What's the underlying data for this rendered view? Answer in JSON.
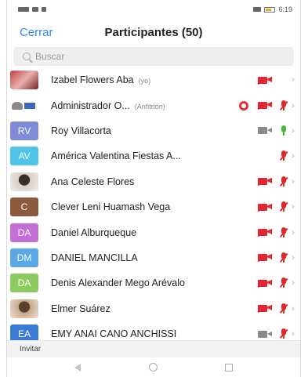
{
  "status_bar": {
    "time": "6:19",
    "battery_icon": "battery-icon",
    "signal_icon": "signal-icon"
  },
  "header": {
    "close_label": "Cerrar",
    "title": "Participantes (50)"
  },
  "search": {
    "placeholder": "Buscar"
  },
  "participants": [
    {
      "name": "Izabel Flowers Aba",
      "tag": "(yo)",
      "avatar": "photo",
      "avatar_text": "",
      "avatar_color": "#c04040",
      "rec": false,
      "cam": "off",
      "mic": "none"
    },
    {
      "name": "Administrador O...",
      "tag": "(Anfitrión)",
      "avatar": "logo",
      "avatar_text": "",
      "avatar_color": "#ffffff",
      "rec": true,
      "cam": "off",
      "mic": "off"
    },
    {
      "name": "Roy Villacorta",
      "tag": "",
      "avatar": "initials",
      "avatar_text": "RV",
      "avatar_color": "#7f8bd8",
      "rec": false,
      "cam": "on",
      "mic": "on"
    },
    {
      "name": "América Valentina Fiestas A...",
      "tag": "",
      "avatar": "initials",
      "avatar_text": "AV",
      "avatar_color": "#4fc3e8",
      "rec": false,
      "cam": "none",
      "mic": "off"
    },
    {
      "name": "Ana Celeste Flores",
      "tag": "",
      "avatar": "photo2",
      "avatar_text": "",
      "avatar_color": "#3a2e2a",
      "rec": false,
      "cam": "off",
      "mic": "off"
    },
    {
      "name": "Clever Leni Huamash Vega",
      "tag": "",
      "avatar": "initials",
      "avatar_text": "C",
      "avatar_color": "#8b5a3c",
      "rec": false,
      "cam": "off",
      "mic": "off"
    },
    {
      "name": "Daniel Alburqueque",
      "tag": "",
      "avatar": "initials",
      "avatar_text": "DA",
      "avatar_color": "#c36fd6",
      "rec": false,
      "cam": "off",
      "mic": "off"
    },
    {
      "name": "DANIEL MANCILLA",
      "tag": "",
      "avatar": "initials",
      "avatar_text": "DM",
      "avatar_color": "#5aa9e6",
      "rec": false,
      "cam": "off",
      "mic": "off"
    },
    {
      "name": "Denis Alexander Mego Arévalo",
      "tag": "",
      "avatar": "initials",
      "avatar_text": "DA",
      "avatar_color": "#8ccb5e",
      "rec": false,
      "cam": "off",
      "mic": "off"
    },
    {
      "name": "Elmer Suárez",
      "tag": "",
      "avatar": "photo3",
      "avatar_text": "",
      "avatar_color": "#5a4030",
      "rec": false,
      "cam": "off",
      "mic": "off"
    },
    {
      "name": "EMY ANAI CANO ANCHISSI",
      "tag": "",
      "avatar": "initials",
      "avatar_text": "EA",
      "avatar_color": "#3a7bd5",
      "rec": false,
      "cam": "on",
      "mic": "off"
    }
  ],
  "footer": {
    "invite_label": "Invitar"
  },
  "colors": {
    "accent": "#2d8cff",
    "muted_red": "#e0262f",
    "unmuted_green": "#47b83a"
  }
}
